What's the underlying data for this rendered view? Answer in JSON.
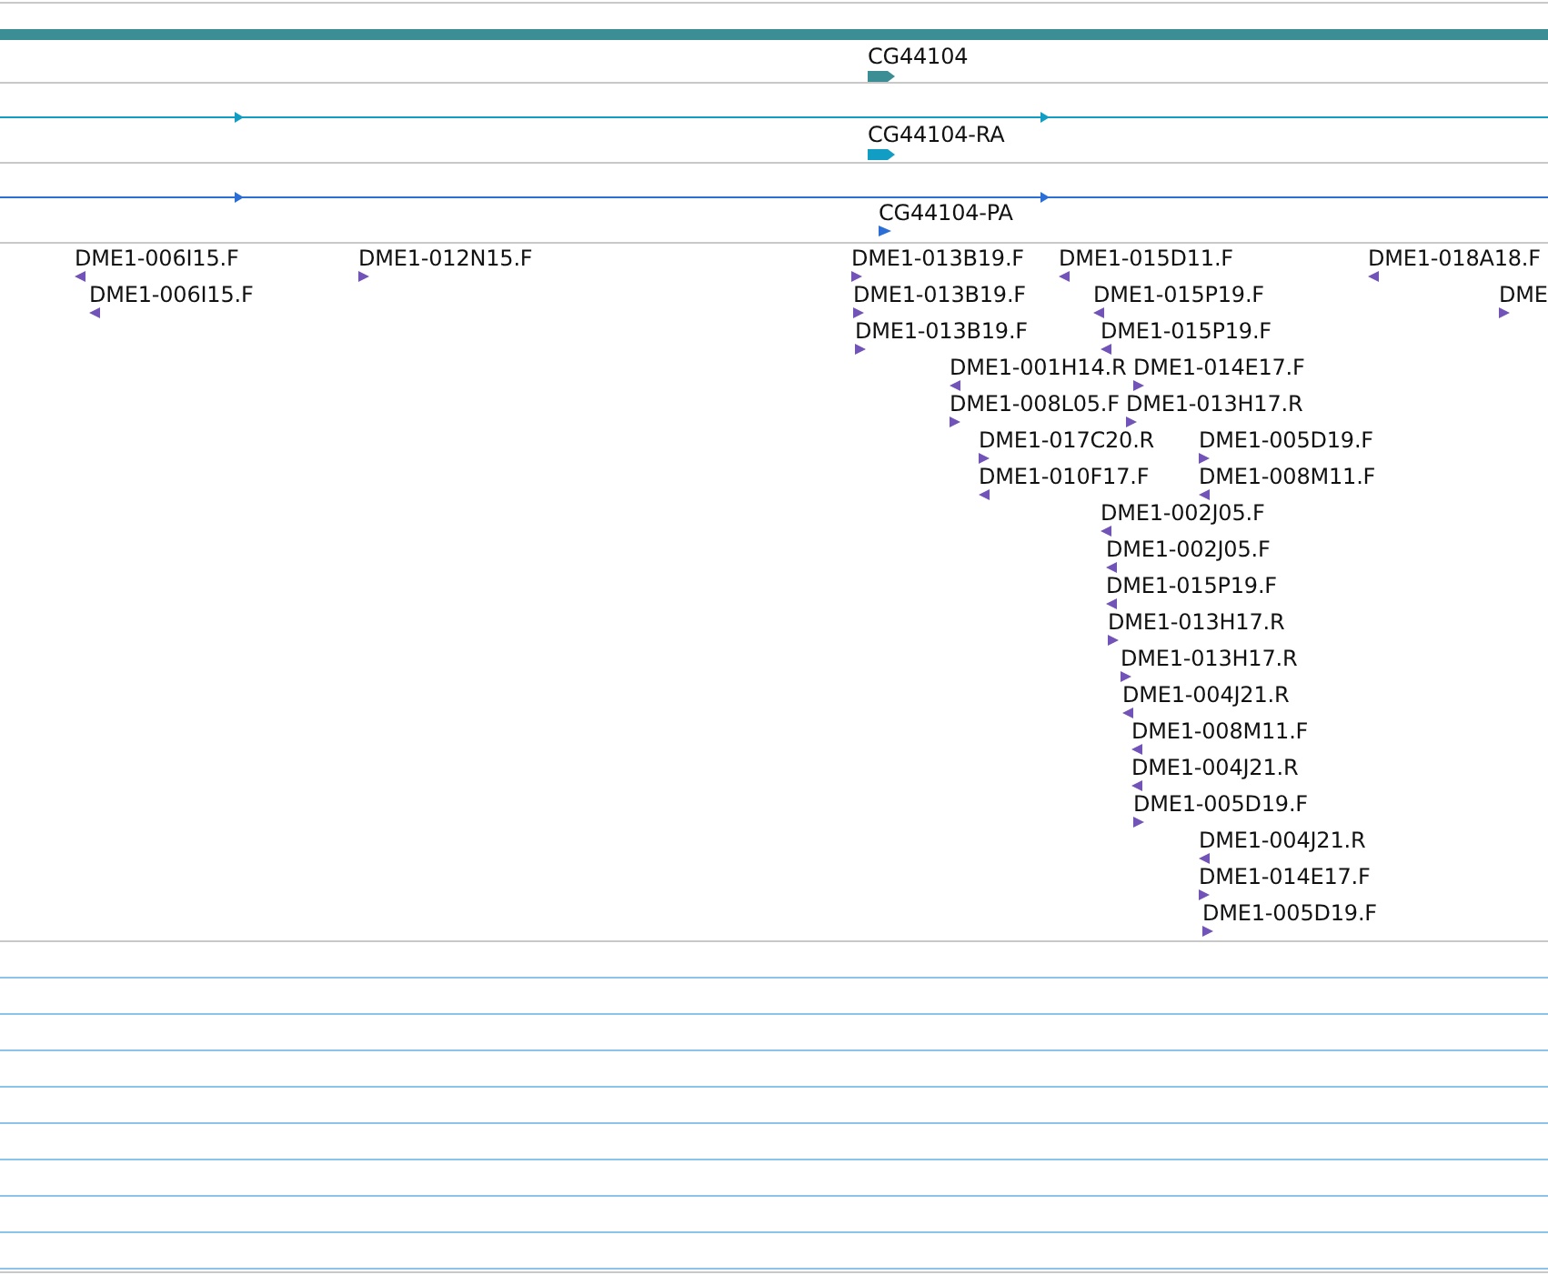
{
  "gene_tracks": [
    {
      "label": "CG44104",
      "kind": "gene"
    },
    {
      "label": "CG44104-RA",
      "kind": "transcript"
    },
    {
      "label": "CG44104-PA",
      "kind": "protein"
    }
  ],
  "alignment_rows": [
    [
      {
        "label": "DME1-006I15.F",
        "reverse": true
      },
      {
        "label": "DME1-012N15.F",
        "reverse": false
      },
      {
        "label": "DME1-013B19.F",
        "reverse": false
      },
      {
        "label": "DME1-015D11.F",
        "reverse": true
      },
      {
        "label": "DME1-018A18.F",
        "reverse": true
      }
    ],
    [
      {
        "label": "DME1-006I15.F",
        "reverse": true
      },
      {
        "label": "DME1-013B19.F",
        "reverse": false
      },
      {
        "label": "DME1-015P19.F",
        "reverse": true
      },
      {
        "label": "DME",
        "reverse": false
      }
    ],
    [
      {
        "label": "DME1-013B19.F",
        "reverse": false
      },
      {
        "label": "DME1-015P19.F",
        "reverse": true
      }
    ],
    [
      {
        "label": "DME1-001H14.R",
        "reverse": true
      },
      {
        "label": "DME1-014E17.F",
        "reverse": false
      }
    ],
    [
      {
        "label": "DME1-008L05.F",
        "reverse": false
      },
      {
        "label": "DME1-013H17.R",
        "reverse": false
      }
    ],
    [
      {
        "label": "DME1-017C20.R",
        "reverse": false
      },
      {
        "label": "DME1-005D19.F",
        "reverse": false
      }
    ],
    [
      {
        "label": "DME1-010F17.F",
        "reverse": true
      },
      {
        "label": "DME1-008M11.F",
        "reverse": true
      }
    ],
    [
      {
        "label": "DME1-002J05.F",
        "reverse": true
      }
    ],
    [
      {
        "label": "DME1-002J05.F",
        "reverse": true
      }
    ],
    [
      {
        "label": "DME1-015P19.F",
        "reverse": true
      }
    ],
    [
      {
        "label": "DME1-013H17.R",
        "reverse": false
      }
    ],
    [
      {
        "label": "DME1-013H17.R",
        "reverse": false
      }
    ],
    [
      {
        "label": "DME1-004J21.R",
        "reverse": true
      }
    ],
    [
      {
        "label": "DME1-008M11.F",
        "reverse": true
      }
    ],
    [
      {
        "label": "DME1-004J21.R",
        "reverse": true
      }
    ],
    [
      {
        "label": "DME1-005D19.F",
        "reverse": false
      }
    ],
    [
      {
        "label": "DME1-004J21.R",
        "reverse": true
      }
    ],
    [
      {
        "label": "DME1-014E17.F",
        "reverse": false
      }
    ],
    [
      {
        "label": "DME1-005D19.F",
        "reverse": false
      }
    ]
  ]
}
